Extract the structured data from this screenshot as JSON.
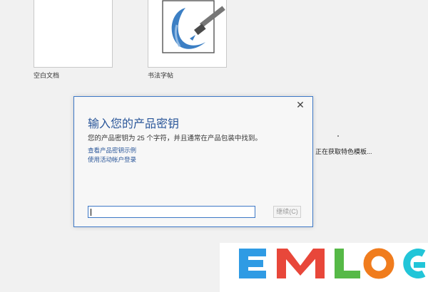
{
  "templates": [
    {
      "label": "空白文档"
    },
    {
      "label": "书法字帖"
    }
  ],
  "status": {
    "loading_text": "正在获取特色模板..."
  },
  "dialog": {
    "title": "输入您的产品密钥",
    "description": "您的产品密钥为 25 个字符，并且通常在产品包装中找到。",
    "link_example": "查看产品密钥示例",
    "link_account": "使用活动帐户登录",
    "key_value": "",
    "continue_label": "继续(C)",
    "close_glyph": "✕"
  },
  "watermark": {
    "letters": [
      "E",
      "M",
      "L",
      "O",
      "G"
    ],
    "colors": [
      "#2f9be4",
      "#e8473a",
      "#56b947",
      "#f07c1d",
      "#22c5d8"
    ]
  }
}
